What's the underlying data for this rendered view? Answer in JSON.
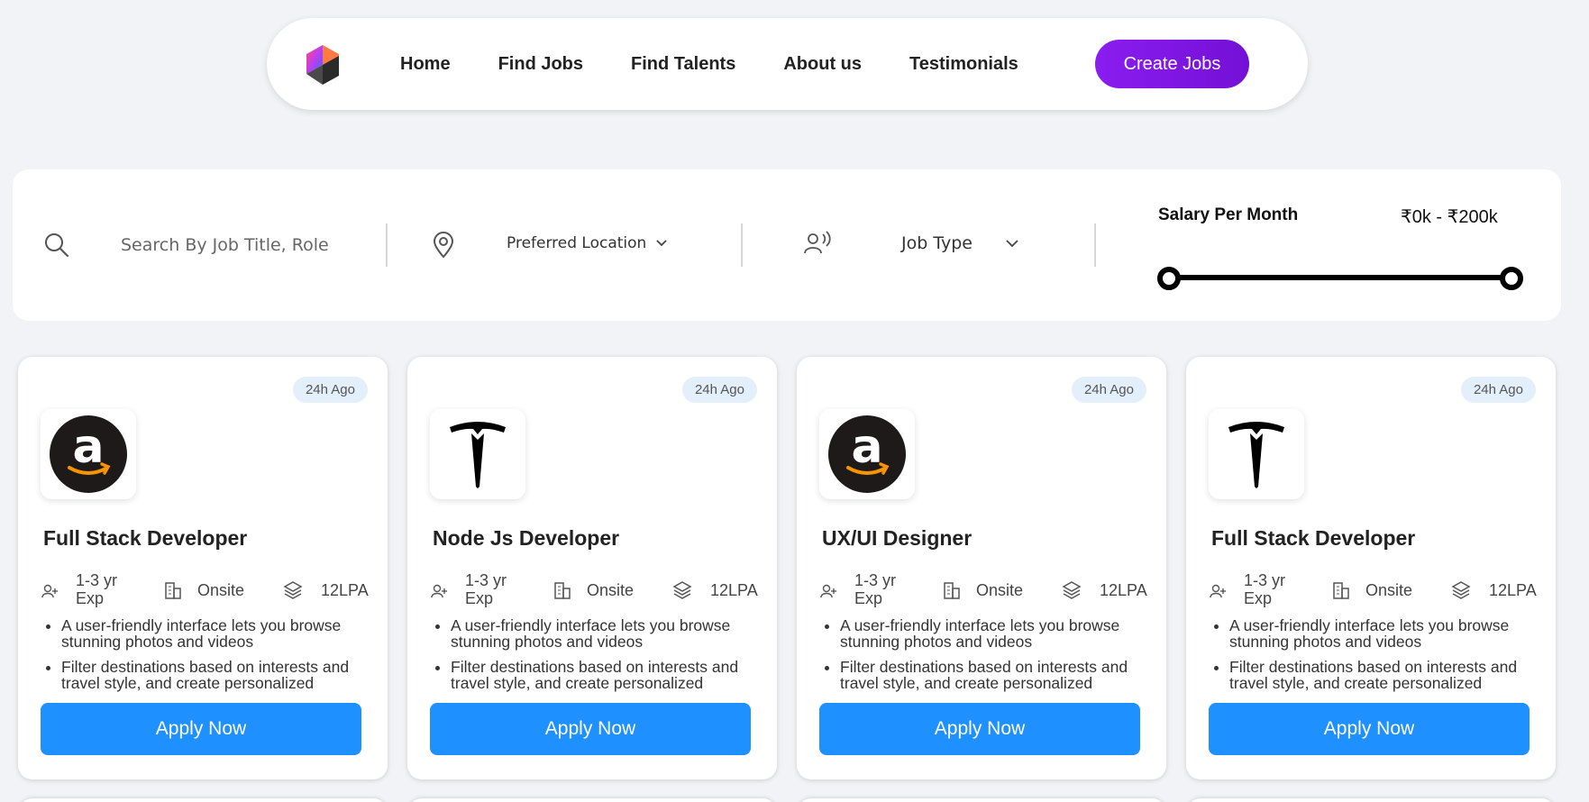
{
  "nav": {
    "links": [
      "Home",
      "Find Jobs",
      "Find Talents",
      "About us",
      "Testimonials"
    ],
    "create_label": "Create Jobs",
    "accent": "#7e16e4"
  },
  "filters": {
    "search_placeholder": "Search By Job Title, Role",
    "location_label": "Preferred Location",
    "job_type_label": "Job Type",
    "salary_title": "Salary Per Month",
    "salary_range": "₹0k - ₹200k",
    "salary_min_fraction": 0,
    "salary_max_fraction": 1
  },
  "jobs": [
    {
      "posted": "24h Ago",
      "company_logo": "amazon-logo",
      "title": "Full Stack Developer",
      "exp": "1-3 yr Exp",
      "mode": "Onsite",
      "salary": "12LPA",
      "points": [
        "A user-friendly interface lets you browse stunning photos and videos",
        "Filter destinations based on interests and travel style, and create personalized"
      ],
      "apply_label": "Apply Now"
    },
    {
      "posted": "24h Ago",
      "company_logo": "tesla-logo",
      "title": "Node Js Developer",
      "exp": "1-3 yr Exp",
      "mode": "Onsite",
      "salary": "12LPA",
      "points": [
        "A user-friendly interface lets you browse stunning photos and videos",
        "Filter destinations based on interests and travel style, and create personalized"
      ],
      "apply_label": "Apply Now"
    },
    {
      "posted": "24h Ago",
      "company_logo": "amazon-logo",
      "title": "UX/UI Designer",
      "exp": "1-3 yr Exp",
      "mode": "Onsite",
      "salary": "12LPA",
      "points": [
        "A user-friendly interface lets you browse stunning photos and videos",
        "Filter destinations based on interests and travel style, and create personalized"
      ],
      "apply_label": "Apply Now"
    },
    {
      "posted": "24h Ago",
      "company_logo": "tesla-logo",
      "title": "Full Stack Developer",
      "exp": "1-3 yr Exp",
      "mode": "Onsite",
      "salary": "12LPA",
      "points": [
        "A user-friendly interface lets you browse stunning photos and videos",
        "Filter destinations based on interests and travel style, and create personalized"
      ],
      "apply_label": "Apply Now"
    }
  ],
  "colors": {
    "apply_button": "#1e90ff",
    "badge_bg": "#e3effb",
    "page_bg": "#f2f3f6"
  }
}
